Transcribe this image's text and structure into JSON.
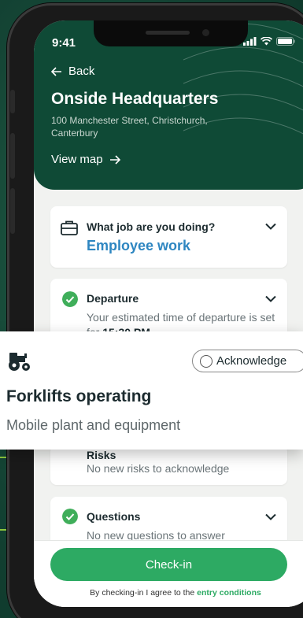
{
  "status": {
    "time": "9:41"
  },
  "header": {
    "back_label": "Back",
    "title": "Onside Headquarters",
    "address": "100 Manchester Street, Christchurch, Canterbury",
    "view_map_label": "View map"
  },
  "job_card": {
    "question": "What job are you doing?",
    "value": "Employee work"
  },
  "departure_card": {
    "label": "Departure",
    "text_prefix": "Your estimated time of departure is set for ",
    "time": "15:30 PM"
  },
  "risks_card": {
    "label": "Risks",
    "text": "No new risks to acknowledge"
  },
  "questions_card": {
    "label": "Questions",
    "text": "No new questions to answer"
  },
  "footer": {
    "checkin_label": "Check-in",
    "agree_prefix": "By checking-in I agree to the ",
    "agree_link": "entry conditions"
  },
  "risk_popup": {
    "icon": "tractor-icon",
    "acknowledge_label": "Acknowledge",
    "title": "Forklifts operating",
    "subtitle": "Mobile plant and equipment"
  },
  "colors": {
    "brand_dark": "#0f4a36",
    "accent_green": "#2daa63",
    "link_blue": "#2e86c1"
  }
}
